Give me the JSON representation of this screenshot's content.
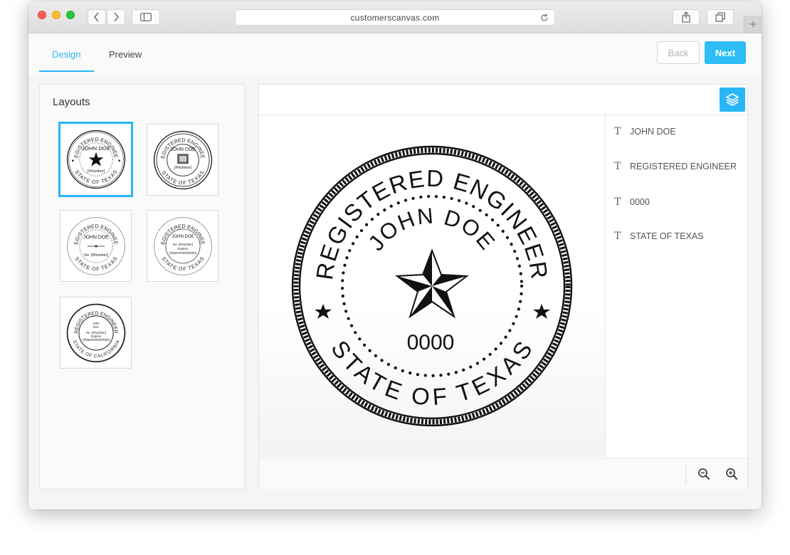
{
  "browser": {
    "url": "customerscanvas.com",
    "new_tab_glyph": "+"
  },
  "tabs": {
    "design": "Design",
    "preview": "Preview"
  },
  "actions": {
    "back": "Back",
    "next": "Next"
  },
  "layouts": {
    "title": "Layouts",
    "thumbnails": [
      {
        "top": "REGISTERED ENGINEER",
        "name": "JOHN DOE",
        "number": "[#Number]",
        "bottom": "STATE OF TEXAS",
        "selected": true
      },
      {
        "top": "REGISTERED ENGINEER",
        "name": "JOHN DOE",
        "number": "[#Number]",
        "bottom": "STATE OF TEXAS",
        "selected": false
      },
      {
        "top": "REGISTERED ENGINEER",
        "name": "JOHN DOE",
        "number": "No. [#Number]",
        "bottom": "STATE OF TEXAS",
        "selected": false
      },
      {
        "top": "REGISTERED ENGINEER",
        "name": "JOHN DOE",
        "line1": "No. [#Number]",
        "line2": "Expires",
        "line3": "[#Date#00/00/0000]",
        "bottom": "STATE OF TEXAS",
        "selected": false
      },
      {
        "top": "REGISTERED ENGINEER",
        "line0": "John",
        "line0b": "Doe",
        "line1": "No. [#Number]",
        "line2": "Expires",
        "line3": "[#Date#00/00/0000]",
        "bottom": "STATE OF CALIFORNIA",
        "selected": false
      }
    ]
  },
  "seal": {
    "top_text": "REGISTERED ENGINEER",
    "name": "JOHN DOE",
    "number": "0000",
    "bottom_text": "STATE OF TEXAS"
  },
  "items": [
    {
      "icon": "text-icon",
      "glyph": "T",
      "label": "JOHN DOE"
    },
    {
      "icon": "text-icon",
      "glyph": "T",
      "label": "REGISTERED ENGINEER"
    },
    {
      "icon": "text-icon",
      "glyph": "T",
      "label": "0000"
    },
    {
      "icon": "text-icon",
      "glyph": "T",
      "label": "STATE OF TEXAS"
    }
  ],
  "colors": {
    "accent": "#29b6f6",
    "next_button": "#2ebdf5"
  }
}
